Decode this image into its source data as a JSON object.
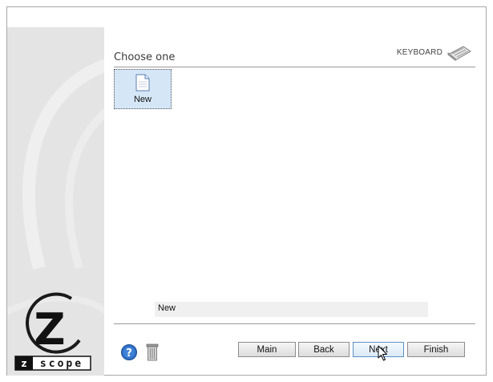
{
  "header": {
    "title": "Choose one",
    "keyboard_label": "KEYBOARD",
    "keyboard_icon": "keyboard-icon"
  },
  "items": [
    {
      "label": "New",
      "icon": "new-document-icon",
      "selected": true
    }
  ],
  "description": "New",
  "footer": {
    "help_icon": "help-icon",
    "trash_icon": "trash-icon",
    "main_label": "Main",
    "back_label": "Back",
    "next_label": "Next",
    "finish_label": "Finish"
  },
  "brand": {
    "logo_letter": "Z",
    "logo_word": "scope"
  },
  "colors": {
    "selection": "#d5e6f7",
    "sidebar": "#e4e4e4",
    "help_blue": "#2f6fc4",
    "next_border": "#5b8fc4"
  }
}
